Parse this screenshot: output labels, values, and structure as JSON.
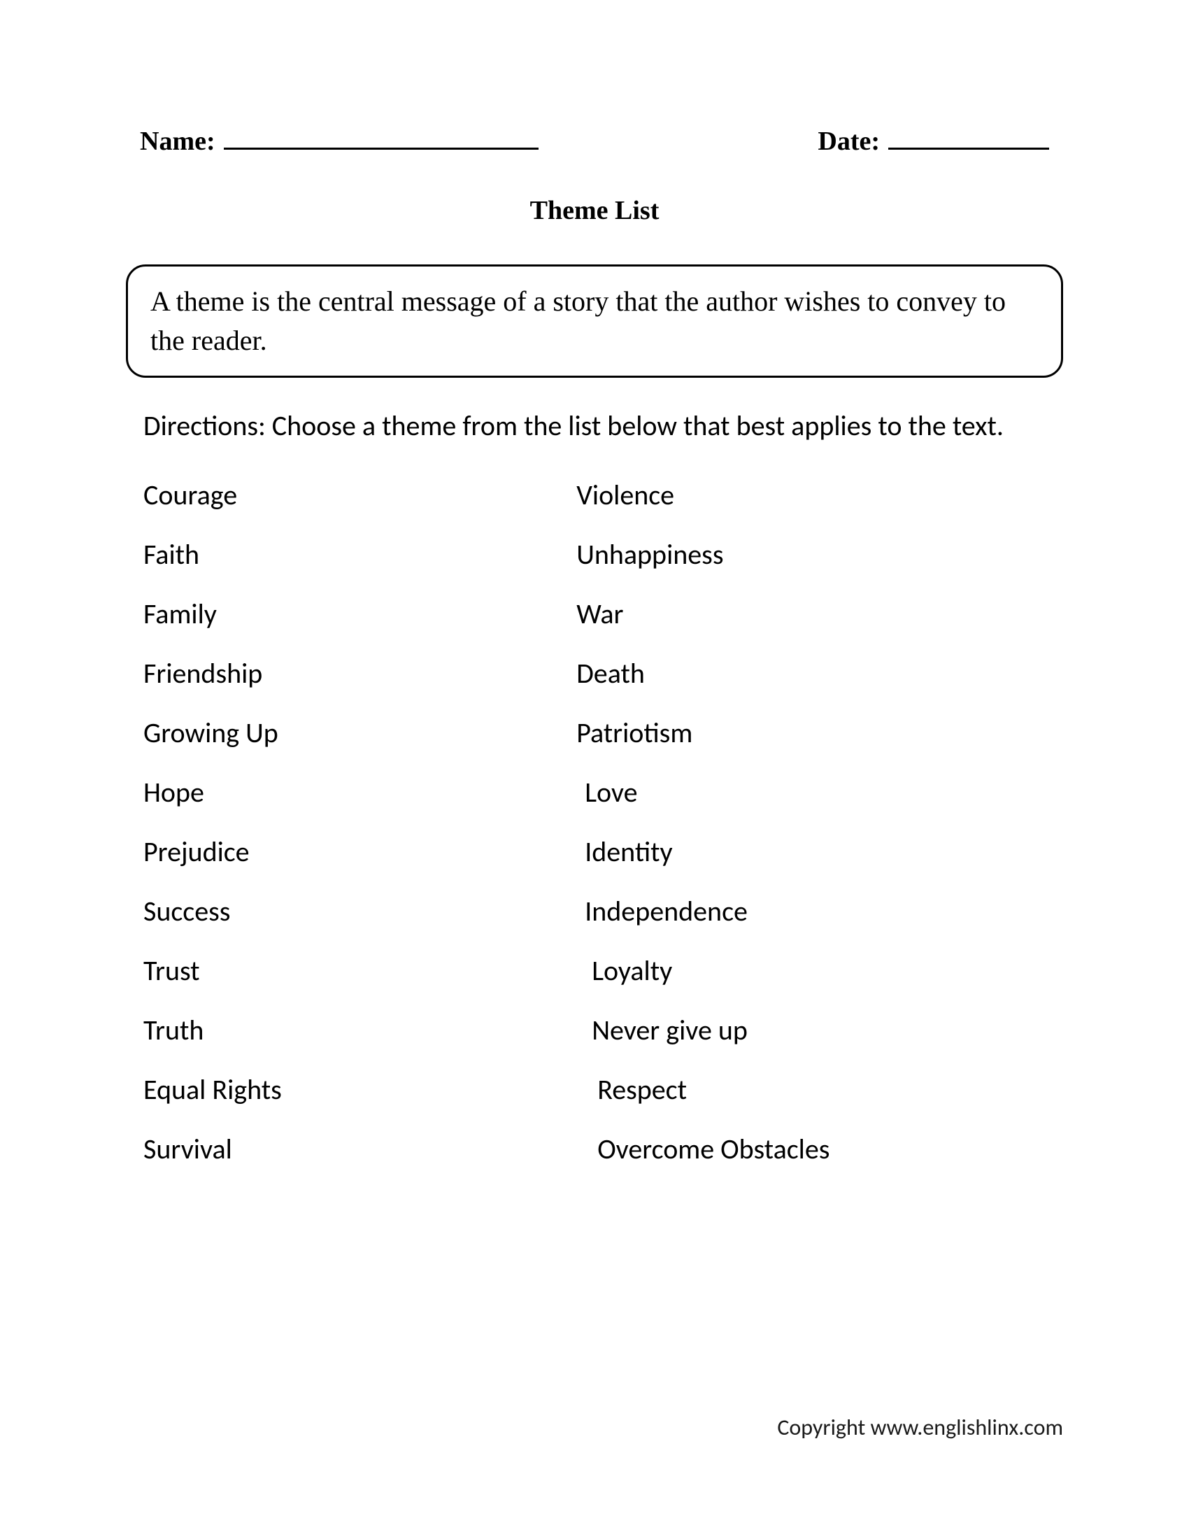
{
  "header": {
    "name_label": "Name:",
    "date_label": "Date:"
  },
  "title": "Theme List",
  "definition": "A theme is the central message of a story that the author wishes to convey to the reader.",
  "directions": "Directions: Choose a theme from the list below that best applies to the text.",
  "themes_left": [
    "Courage",
    "Faith",
    "Family",
    "Friendship",
    "Growing Up",
    "Hope",
    "Prejudice",
    "Success",
    "Trust",
    "Truth",
    "Equal Rights",
    "Survival"
  ],
  "themes_right": [
    "Violence",
    "Unhappiness",
    "War",
    "Death",
    "Patriotism",
    "Love",
    "Identity",
    "Independence",
    "Loyalty",
    "Never give up",
    "Respect",
    "Overcome Obstacles"
  ],
  "right_indents": [
    "",
    "",
    "",
    "",
    "",
    "indent-small",
    "indent-small",
    "indent-small",
    "indent-med",
    "indent-med",
    "indent-large",
    "indent-large"
  ],
  "copyright": "Copyright www.englishlinx.com"
}
